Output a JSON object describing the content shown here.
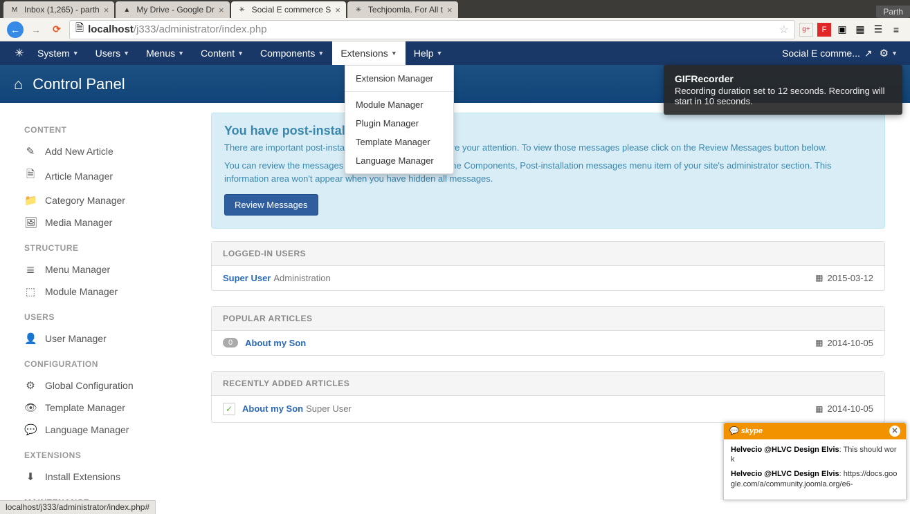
{
  "browser": {
    "tabs": [
      {
        "favicon": "M",
        "label": "Inbox (1,265) - parth"
      },
      {
        "favicon": "▲",
        "label": "My Drive - Google Dr"
      },
      {
        "favicon": "✳",
        "label": "Social E commerce S",
        "active": true
      },
      {
        "favicon": "✳",
        "label": "Techjoomla. For All t"
      }
    ],
    "user": "Parth",
    "url_host": "localhost",
    "url_path": "/j333/administrator/index.php"
  },
  "topmenu": [
    "System",
    "Users",
    "Menus",
    "Content",
    "Components",
    "Extensions",
    "Help"
  ],
  "topmenu_open_index": 5,
  "site_name": "Social E comme...",
  "dropdown": {
    "groups": [
      [
        "Extension Manager"
      ],
      [
        "Module Manager",
        "Plugin Manager",
        "Template Manager",
        "Language Manager"
      ]
    ]
  },
  "page_title": "Control Panel",
  "sidebar": [
    {
      "head": "CONTENT",
      "items": [
        {
          "icon": "✎",
          "label": "Add New Article"
        },
        {
          "icon": "🗎",
          "label": "Article Manager"
        },
        {
          "icon": "📁",
          "label": "Category Manager"
        },
        {
          "icon": "🖼",
          "label": "Media Manager"
        }
      ]
    },
    {
      "head": "STRUCTURE",
      "items": [
        {
          "icon": "≣",
          "label": "Menu Manager"
        },
        {
          "icon": "⬚",
          "label": "Module Manager"
        }
      ]
    },
    {
      "head": "USERS",
      "items": [
        {
          "icon": "👤",
          "label": "User Manager"
        }
      ]
    },
    {
      "head": "CONFIGURATION",
      "items": [
        {
          "icon": "⚙",
          "label": "Global Configuration"
        },
        {
          "icon": "👁",
          "label": "Template Manager"
        },
        {
          "icon": "💬",
          "label": "Language Manager"
        }
      ]
    },
    {
      "head": "EXTENSIONS",
      "items": [
        {
          "icon": "⬇",
          "label": "Install Extensions"
        }
      ]
    },
    {
      "head": "MAINTENANCE",
      "items": []
    }
  ],
  "alert": {
    "title": "You have post-installation messages",
    "line1": "There are important post-installation messages that require your attention. To view those messages please click on the Review Messages button below.",
    "line2": "You can review the messages at any time by clicking on the Components, Post-installation messages menu item of your site's administrator section. This information area won't appear when you have hidden all messages.",
    "button": "Review Messages"
  },
  "panels": {
    "logged_in": {
      "title": "LOGGED-IN USERS",
      "user": "Super User",
      "role": "Administration",
      "date": "2015-03-12"
    },
    "popular": {
      "title": "POPULAR ARTICLES",
      "badge": "0",
      "article": "About my Son",
      "date": "2014-10-05"
    },
    "recent": {
      "title": "RECENTLY ADDED ARTICLES",
      "article": "About my Son",
      "author": "Super User",
      "date": "2014-10-05"
    }
  },
  "gifrec": {
    "title": "GIFRecorder",
    "body": "Recording duration set to 12 seconds. Recording will start in 10 seconds."
  },
  "skype": {
    "brand": "skype",
    "messages": [
      {
        "from": "Helvecio @HLVC Design Elvis",
        "text": ": This should work"
      },
      {
        "from": "Helvecio @HLVC Design Elvis",
        "text": ": https://docs.google.com/a/community.joomla.org/e6-"
      }
    ]
  },
  "statusbar": "localhost/j333/administrator/index.php#"
}
